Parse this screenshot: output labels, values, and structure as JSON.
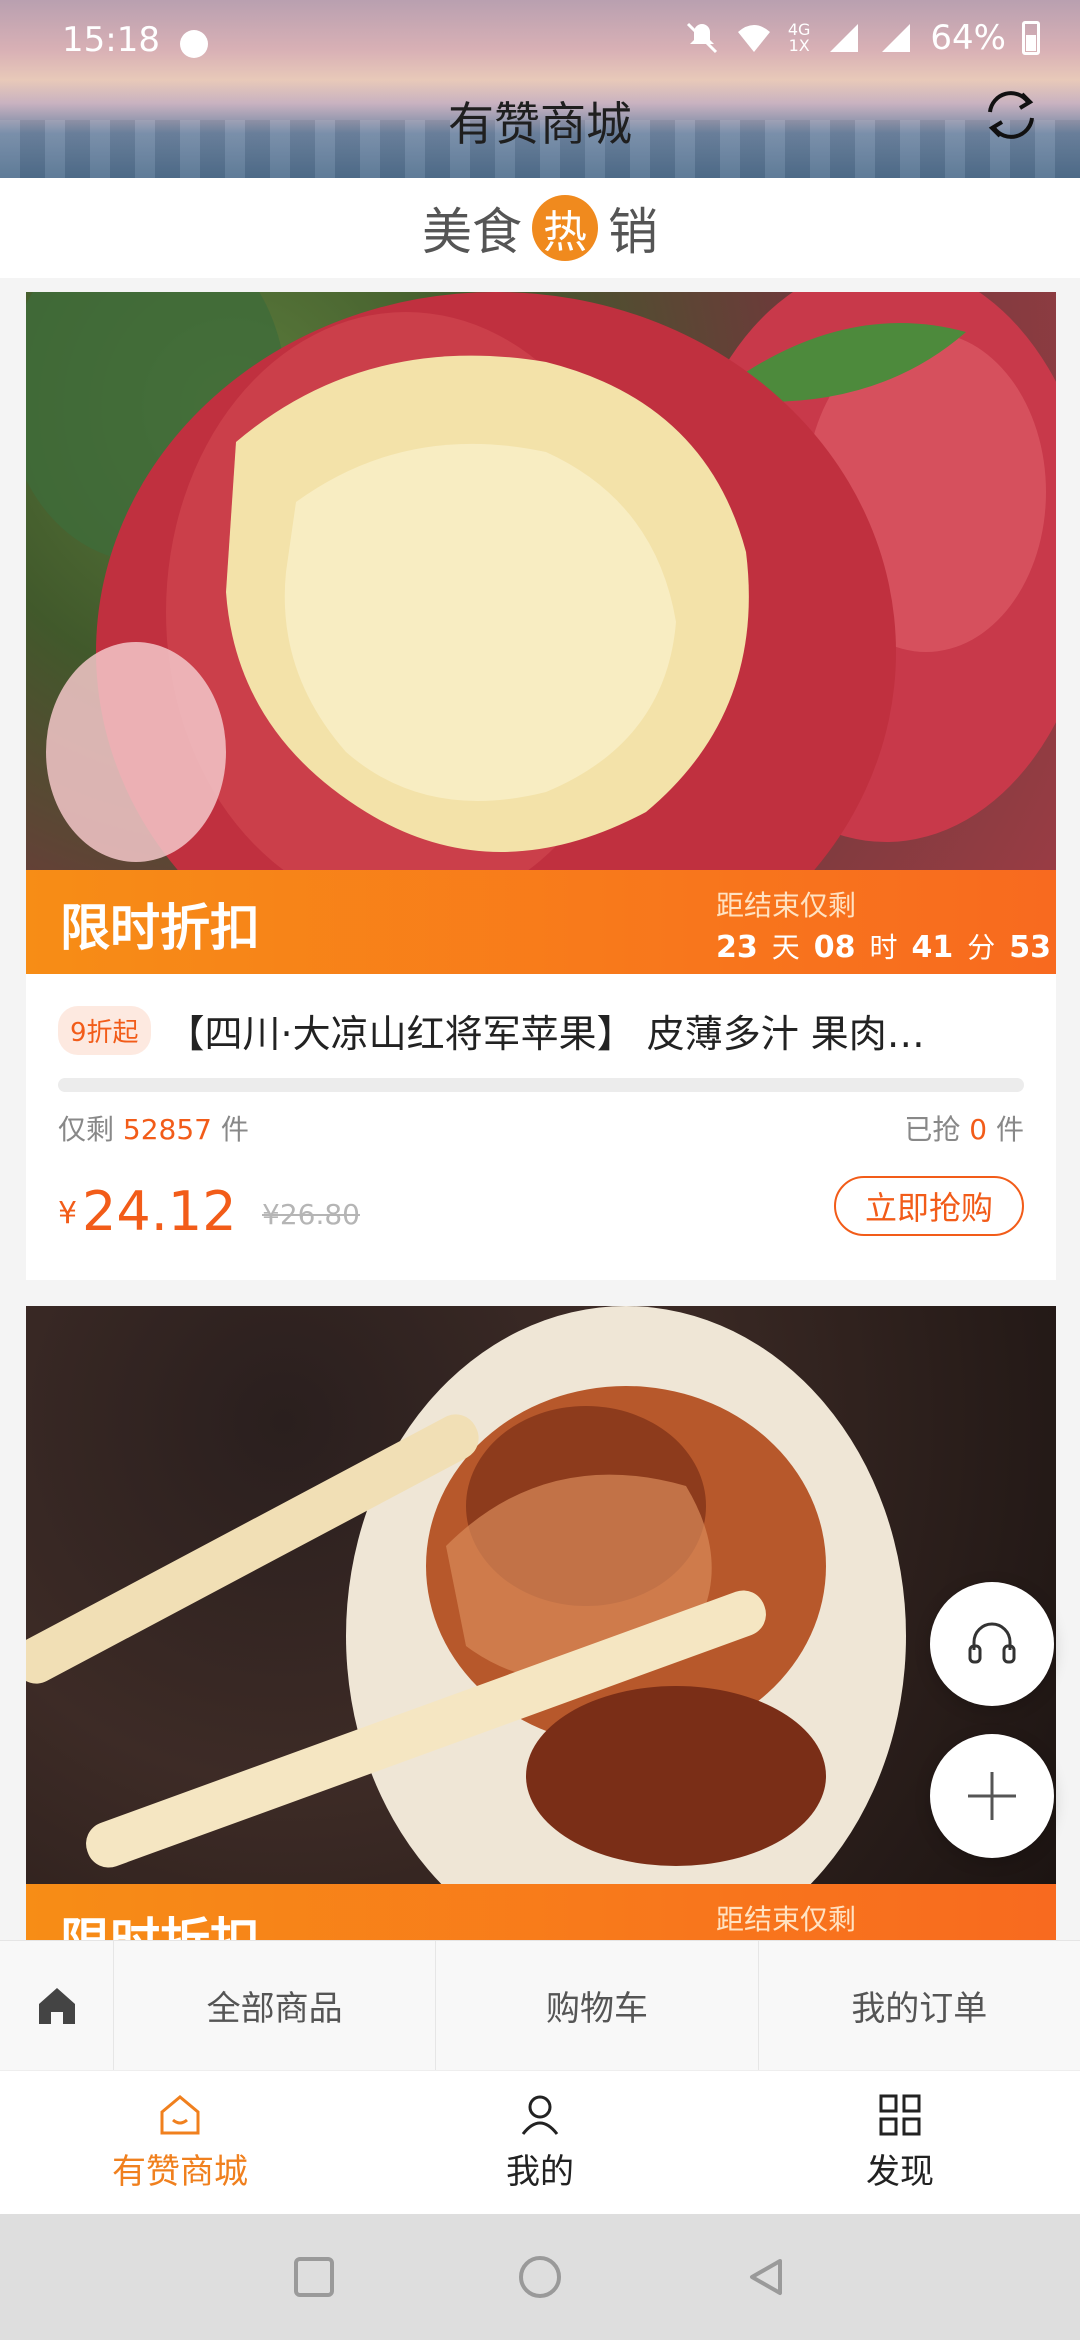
{
  "status_bar": {
    "time": "15:18",
    "network_tag_top": "4G",
    "network_tag_bottom": "1X",
    "battery": "64%"
  },
  "header": {
    "title": "有赞商城",
    "refresh_icon": "refresh-icon"
  },
  "banner": {
    "left": "美食",
    "hot": "热",
    "right": "销"
  },
  "products": [
    {
      "flash_label": "限时折扣",
      "remaining_label": "距结束仅剩",
      "countdown": {
        "days": "23",
        "days_unit": "天",
        "hours": "08",
        "hours_unit": "时",
        "minutes": "41",
        "minutes_unit": "分",
        "seconds": "53"
      },
      "discount_tag": "9折起",
      "title": "【四川·大凉山红将军苹果】 皮薄多汁 果肉…",
      "stock_prefix": "仅剩",
      "stock_left": "52857",
      "stock_unit": "件",
      "sold_prefix": "已抢",
      "sold": "0",
      "sold_unit": "件",
      "progress": 0,
      "currency": "¥",
      "price": "24.12",
      "original_price": "¥26.80",
      "buy_label": "立即抢购"
    },
    {
      "flash_label": "限时折扣",
      "remaining_label": "距结束仅剩"
    }
  ],
  "shop_nav": {
    "home_icon": "home-icon",
    "items": [
      "全部商品",
      "购物车",
      "我的订单"
    ]
  },
  "tabbar": {
    "tabs": [
      {
        "label": "有赞商城",
        "icon": "store-icon",
        "active": true
      },
      {
        "label": "我的",
        "icon": "person-icon",
        "active": false
      },
      {
        "label": "发现",
        "icon": "grid-icon",
        "active": false
      }
    ]
  },
  "colors": {
    "accent": "#f25c19",
    "flash_gradient_start": "#f78d16",
    "flash_gradient_end": "#f86a1f",
    "tab_active": "#f0801e"
  }
}
